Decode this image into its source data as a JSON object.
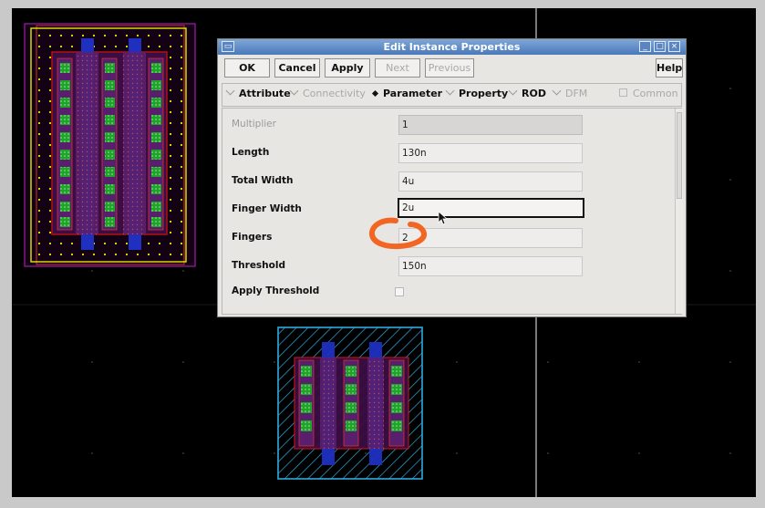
{
  "dialog": {
    "title": "Edit Instance Properties",
    "buttons": {
      "ok": "OK",
      "cancel": "Cancel",
      "apply": "Apply",
      "next": "Next",
      "previous": "Previous",
      "help": "Help"
    },
    "tabs": [
      {
        "label": "Attribute",
        "state": "unselected"
      },
      {
        "label": "Connectivity",
        "state": "disabled"
      },
      {
        "label": "Parameter",
        "state": "selected"
      },
      {
        "label": "Property",
        "state": "unselected"
      },
      {
        "label": "ROD",
        "state": "unselected"
      },
      {
        "label": "DFM",
        "state": "disabled"
      }
    ],
    "common_label": "Common",
    "parameters": [
      {
        "label": "Multiplier",
        "value": "1",
        "state": "readonly"
      },
      {
        "label": "Length",
        "value": "130n",
        "state": "normal"
      },
      {
        "label": "Total Width",
        "value": "4u",
        "state": "normal"
      },
      {
        "label": "Finger Width",
        "value": "2u",
        "state": "active"
      },
      {
        "label": "Fingers",
        "value": "2",
        "state": "normal"
      },
      {
        "label": "Threshold",
        "value": "150n",
        "state": "normal"
      },
      {
        "label": "Apply Threshold",
        "value": "",
        "state": "checkbox"
      }
    ]
  },
  "colors": {
    "canvas_background": "#000000",
    "title_bar": "#4a79b9",
    "dialog_background": "#e8e6e3",
    "annotation": "#f26522",
    "diffusion_green": "#1fa32a",
    "poly_blue": "#1f2fbf",
    "metal_purple": "#7e1fa8",
    "boundary_yellow": "#e5e50a",
    "selection_cyan": "#2fa9e0"
  },
  "icons": {
    "window_menu": "window-menu-icon",
    "minimize": "minimize-icon",
    "maximize": "maximize-icon",
    "close": "close-icon",
    "cursor": "mouse-pointer-icon"
  }
}
